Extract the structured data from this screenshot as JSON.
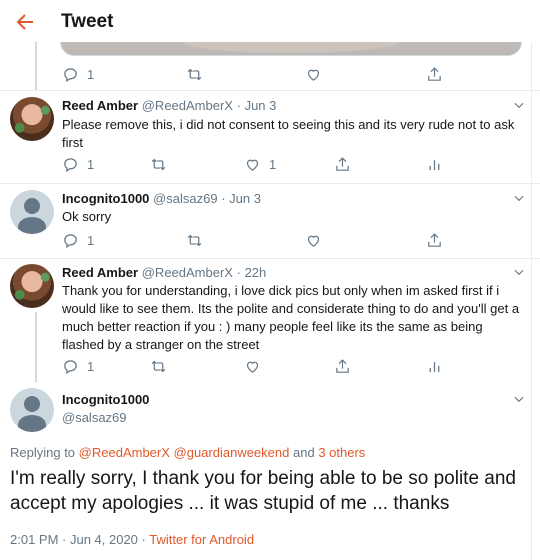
{
  "header": {
    "title": "Tweet"
  },
  "colors": {
    "accent": "#e0592a",
    "icon_gray": "#657786"
  },
  "top_tweet_actions": {
    "reply_count": "1"
  },
  "replies": [
    {
      "name": "Reed Amber",
      "handle": "@ReedAmberX",
      "time": "Jun 3",
      "text": "Please remove this, i did not consent to seeing this and its very rude not to ask first",
      "reply_count": "1",
      "like_count": "1"
    },
    {
      "name": "Incognito1000",
      "handle": "@salsaz69",
      "time": "Jun 3",
      "text": "Ok sorry",
      "reply_count": "1",
      "like_count": ""
    },
    {
      "name": "Reed Amber",
      "handle": "@ReedAmberX",
      "time": "22h",
      "text": "Thank you for understanding, i love dick pics but only when im asked first if i would like to see them. Its the polite and considerate thing to do and you'll get a much better reaction if you : ) many people feel like its the same as being flashed by a stranger on the street",
      "reply_count": "1",
      "like_count": ""
    }
  ],
  "main_tweet": {
    "name": "Incognito1000",
    "handle": "@salsaz69",
    "replying_prefix": "Replying to",
    "replying_to": "@ReedAmberX @guardianweekend",
    "replying_and": "and",
    "replying_others": "3 others",
    "text": "I'm really sorry, I thank you for being able to be so polite and accept my apologies ... it was stupid of me  ... thanks",
    "time": "2:01 PM · Jun 4, 2020",
    "separator": "·",
    "source": "Twitter for Android"
  },
  "icons": [
    "back-arrow-icon",
    "reply-icon",
    "retweet-icon",
    "like-icon",
    "share-icon",
    "analytics-icon",
    "chevron-down-icon"
  ],
  "dot": "·"
}
